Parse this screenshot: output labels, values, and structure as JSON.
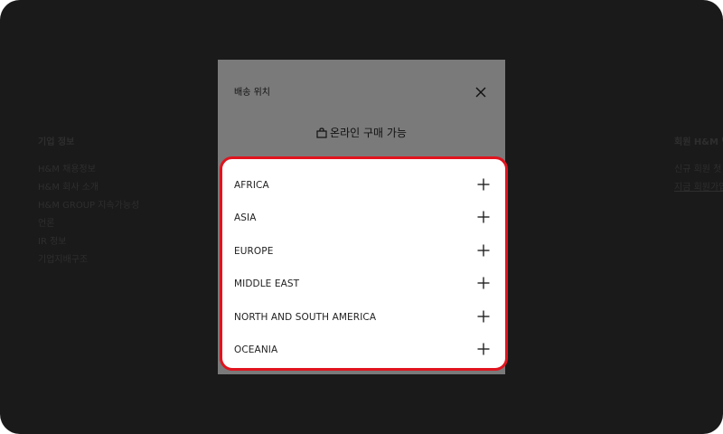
{
  "background": {
    "left_column": {
      "heading": "기업 정보",
      "links": [
        "H&M 채용정보",
        "H&M 회사 소개",
        "H&M GROUP 지속가능성",
        "언론",
        "IR 정보",
        "기업지배구조"
      ]
    },
    "right_column": {
      "heading": "회원 H&M 멤",
      "links": [
        "신규 회원 첫",
        "지금 회원가입"
      ]
    }
  },
  "modal": {
    "title": "배송 위치",
    "online_label": "온라인 구매 가능",
    "regions": [
      {
        "label": "AFRICA"
      },
      {
        "label": "ASIA"
      },
      {
        "label": "EUROPE"
      },
      {
        "label": "MIDDLE EAST"
      },
      {
        "label": "NORTH AND SOUTH AMERICA"
      },
      {
        "label": "OCEANIA"
      }
    ]
  },
  "colors": {
    "highlight_border": "#e0141e",
    "overlay": "#1a1a1a",
    "modal_dimmed": "#7a7a7a"
  }
}
